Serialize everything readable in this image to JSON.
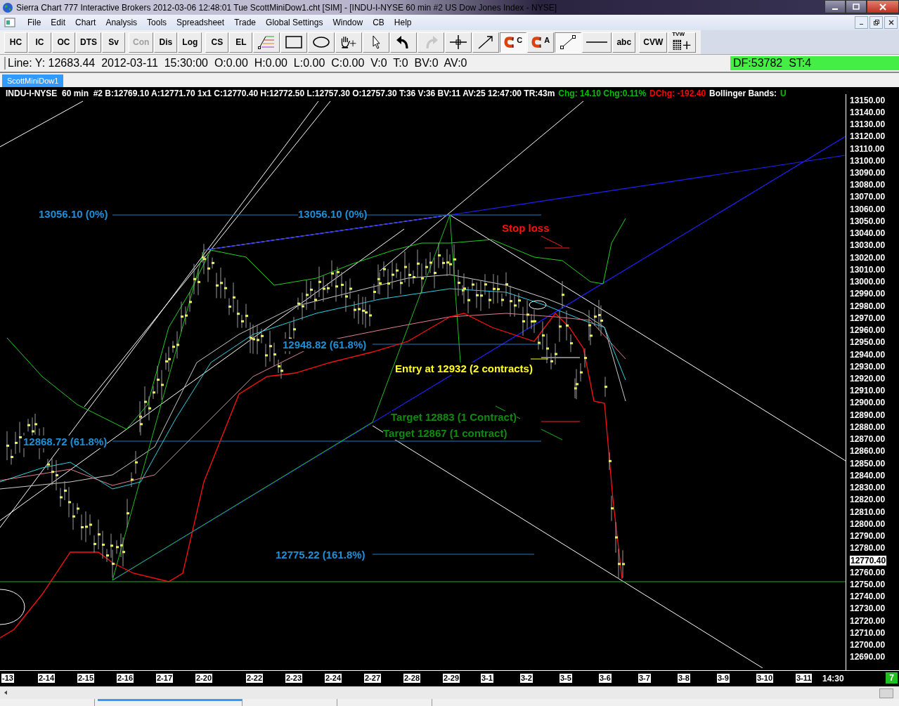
{
  "window": {
    "title": "Sierra Chart 777 Interactive Brokers 2012-03-06  12:48:01 Tue  ScottMiniDow1.cht [SIM] - [INDU-I-NYSE  60 min  #2  US Dow Jones Index - NYSE]"
  },
  "menu": [
    "File",
    "Edit",
    "Chart",
    "Analysis",
    "Tools",
    "Spreadsheet",
    "Trade",
    "Global Settings",
    "Window",
    "CB",
    "Help"
  ],
  "toolbar_groups": [
    {
      "buttons": [
        {
          "kind": "text",
          "label": "HC",
          "pressed": false,
          "disabled": false
        },
        {
          "kind": "text",
          "label": "IC",
          "pressed": false,
          "disabled": false
        },
        {
          "kind": "text",
          "label": "OC",
          "pressed": false,
          "disabled": false
        },
        {
          "kind": "text",
          "label": "DTS",
          "pressed": false,
          "disabled": false
        },
        {
          "kind": "text",
          "label": "Sv",
          "pressed": false,
          "disabled": false
        }
      ]
    },
    {
      "buttons": [
        {
          "kind": "text",
          "label": "Con",
          "pressed": false,
          "disabled": true
        },
        {
          "kind": "text",
          "label": "Dis",
          "pressed": false,
          "disabled": false
        },
        {
          "kind": "text",
          "label": "Log",
          "pressed": false,
          "disabled": false
        }
      ]
    },
    {
      "buttons": [
        {
          "kind": "text",
          "label": "CS",
          "pressed": false,
          "disabled": false
        },
        {
          "kind": "text",
          "label": "EL",
          "pressed": false,
          "disabled": false
        },
        {
          "kind": "fib",
          "pressed": false,
          "disabled": false
        },
        {
          "kind": "rectangle",
          "pressed": false,
          "disabled": false
        },
        {
          "kind": "ellipse",
          "pressed": false,
          "disabled": false
        },
        {
          "kind": "hand",
          "pressed": false,
          "disabled": false
        },
        {
          "kind": "pointer",
          "pressed": false,
          "disabled": false
        },
        {
          "kind": "undo",
          "pressed": false,
          "disabled": false
        },
        {
          "kind": "redo",
          "pressed": false,
          "disabled": true
        },
        {
          "kind": "crosshair",
          "pressed": false,
          "disabled": false
        },
        {
          "kind": "ray",
          "pressed": false,
          "disabled": false
        },
        {
          "kind": "magnet",
          "label": "C",
          "pressed": true,
          "disabled": false
        },
        {
          "kind": "magnet",
          "label": "A",
          "pressed": false,
          "disabled": false
        },
        {
          "kind": "segment",
          "pressed": true,
          "disabled": false
        },
        {
          "kind": "hline",
          "pressed": false,
          "disabled": false
        },
        {
          "kind": "text",
          "label": "abc",
          "pressed": false,
          "disabled": false
        }
      ]
    },
    {
      "buttons": [
        {
          "kind": "text",
          "label": "CVW",
          "pressed": false,
          "disabled": false
        },
        {
          "kind": "grid",
          "label": "TVW",
          "pressed": false,
          "disabled": false
        }
      ]
    }
  ],
  "info_line": "Line: Y: 12683.44  2012-03-11  15:30:00  O:0.00  H:0.00  L:0.00  C:0.00  V:0  T:0  BV:0  AV:0",
  "status": "DF:53782  ST:4",
  "tabs": [
    {
      "label": "ScottMiniDow1",
      "selected": true
    }
  ],
  "chart_header": [
    {
      "text": "INDU-I-NYSE  60 min  #2 B:12769.10 A:12771.70 1x1 C:12770.40 H:12772.50 L:12757.30 O:12757.30 T:36 V:36 BV:11 AV:25 12:47:00 TR:43m",
      "color": "#ffffff"
    },
    {
      "text": "Chg: 14.10 Chg:0.11%",
      "color": "#00c000"
    },
    {
      "text": "DChg: -192.40",
      "color": "#ff0000"
    },
    {
      "text": "Bollinger Bands:",
      "color": "#ffffff"
    },
    {
      "text": "U",
      "color": "#00c000"
    }
  ],
  "annotations": [
    {
      "text": "13056.10 (0%)",
      "kind": "fib"
    },
    {
      "text": "13056.10 (0%)",
      "kind": "fib"
    },
    {
      "text": "12948.82 (61.8%)",
      "kind": "fib"
    },
    {
      "text": "12868.72 (61.8%)",
      "kind": "fib"
    },
    {
      "text": "12775.22 (161.8%)",
      "kind": "fib"
    },
    {
      "text": "Stop loss",
      "kind": "stop"
    },
    {
      "text": "Entry at 12932 (2 contracts)",
      "kind": "entry"
    },
    {
      "text": "Target 12883 (1 Contract)",
      "kind": "target"
    },
    {
      "text": "Target 12867 (1 contract)",
      "kind": "target"
    }
  ],
  "price_axis": [
    {
      "label": "13150.00",
      "kind": "tick"
    },
    {
      "label": "13140.00",
      "kind": "tick"
    },
    {
      "label": "13130.00",
      "kind": "tick"
    },
    {
      "label": "13120.00",
      "kind": "tick"
    },
    {
      "label": "13110.00",
      "kind": "tick"
    },
    {
      "label": "13100.00",
      "kind": "tick"
    },
    {
      "label": "13090.00",
      "kind": "tick"
    },
    {
      "label": "13080.00",
      "kind": "tick"
    },
    {
      "label": "13070.00",
      "kind": "tick"
    },
    {
      "label": "13060.00",
      "kind": "tick"
    },
    {
      "label": "13050.00",
      "kind": "tick"
    },
    {
      "label": "13040.00",
      "kind": "tick"
    },
    {
      "label": "13030.00",
      "kind": "tick"
    },
    {
      "label": "13020.00",
      "kind": "tick"
    },
    {
      "label": "13010.00",
      "kind": "tick"
    },
    {
      "label": "13000.00",
      "kind": "tick"
    },
    {
      "label": "12990.00",
      "kind": "tick"
    },
    {
      "label": "12980.00",
      "kind": "tick"
    },
    {
      "label": "12970.00",
      "kind": "tick"
    },
    {
      "label": "12960.00",
      "kind": "tick"
    },
    {
      "label": "12950.00",
      "kind": "tick"
    },
    {
      "label": "12940.00",
      "kind": "tick"
    },
    {
      "label": "12930.00",
      "kind": "tick"
    },
    {
      "label": "12920.00",
      "kind": "tick"
    },
    {
      "label": "12910.00",
      "kind": "tick"
    },
    {
      "label": "12900.00",
      "kind": "tick"
    },
    {
      "label": "12890.00",
      "kind": "tick"
    },
    {
      "label": "12880.00",
      "kind": "tick"
    },
    {
      "label": "12870.00",
      "kind": "tick"
    },
    {
      "label": "12860.00",
      "kind": "tick"
    },
    {
      "label": "12850.00",
      "kind": "tick"
    },
    {
      "label": "12840.00",
      "kind": "tick"
    },
    {
      "label": "12830.00",
      "kind": "tick"
    },
    {
      "label": "12820.00",
      "kind": "tick"
    },
    {
      "label": "12810.00",
      "kind": "tick"
    },
    {
      "label": "12800.00",
      "kind": "tick"
    },
    {
      "label": "12790.00",
      "kind": "tick"
    },
    {
      "label": "12780.00",
      "kind": "tick"
    },
    {
      "label": "12770.40",
      "kind": "last"
    },
    {
      "label": "12760.00",
      "kind": "tick"
    },
    {
      "label": "12750.00",
      "kind": "tick"
    },
    {
      "label": "12740.00",
      "kind": "tick"
    },
    {
      "label": "12730.00",
      "kind": "tick"
    },
    {
      "label": "12720.00",
      "kind": "tick"
    },
    {
      "label": "12710.00",
      "kind": "tick"
    },
    {
      "label": "12700.00",
      "kind": "tick"
    },
    {
      "label": "12690.00",
      "kind": "tick"
    }
  ],
  "date_axis": [
    "-13",
    "2-14",
    "2-15",
    "2-16",
    "2-17",
    "2-20",
    "2-22",
    "2-23",
    "2-24",
    "2-27",
    "2-28",
    "2-29",
    "3-1",
    "3-2",
    "3-5",
    "3-6",
    "3-7",
    "3-8",
    "3-9",
    "3-10",
    "3-11"
  ],
  "time_label": "14:30",
  "corner_badge": "7",
  "sheet_tabs": [
    {
      "selected": false
    },
    {
      "selected": true
    },
    {
      "selected": false
    },
    {
      "selected": false
    }
  ]
}
